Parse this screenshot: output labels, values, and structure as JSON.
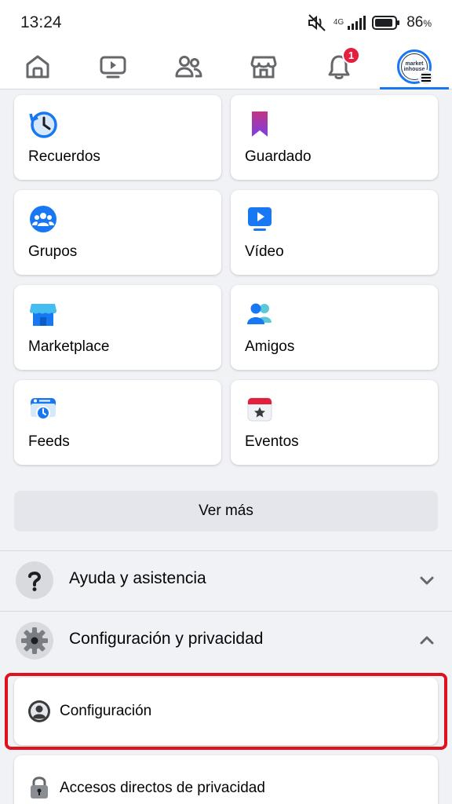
{
  "status_bar": {
    "time": "13:24",
    "network": "4G",
    "battery_percent": "86",
    "battery_unit": "%"
  },
  "tabs": [
    {
      "name": "home-icon"
    },
    {
      "name": "video-icon"
    },
    {
      "name": "friends-icon"
    },
    {
      "name": "marketplace-icon"
    },
    {
      "name": "bell-icon",
      "badge": "1"
    },
    {
      "name": "profile-menu-icon",
      "avatar_text_line1": "market",
      "avatar_text_line2": "inhouse",
      "active": true
    }
  ],
  "shortcuts": [
    {
      "label": "Recuerdos",
      "icon": "memories-clock-icon"
    },
    {
      "label": "Guardado",
      "icon": "saved-bookmark-icon"
    },
    {
      "label": "Grupos",
      "icon": "groups-icon"
    },
    {
      "label": "Vídeo",
      "icon": "video-icon"
    },
    {
      "label": "Marketplace",
      "icon": "marketplace-store-icon"
    },
    {
      "label": "Amigos",
      "icon": "friends-icon"
    },
    {
      "label": "Feeds",
      "icon": "feeds-icon"
    },
    {
      "label": "Eventos",
      "icon": "events-calendar-icon"
    }
  ],
  "see_more_label": "Ver más",
  "sections": {
    "help": {
      "label": "Ayuda y asistencia",
      "icon": "question-icon",
      "expanded": false
    },
    "settings": {
      "label": "Configuración y privacidad",
      "icon": "gear-icon",
      "expanded": true
    }
  },
  "settings_items": [
    {
      "label": "Configuración",
      "icon": "account-settings-icon",
      "highlighted": true
    },
    {
      "label": "Accesos directos de privacidad",
      "icon": "lock-icon"
    }
  ],
  "colors": {
    "accent": "#1877f2",
    "highlight": "#e0101d",
    "badge": "#e41e3f",
    "background": "#f0f2f5"
  }
}
